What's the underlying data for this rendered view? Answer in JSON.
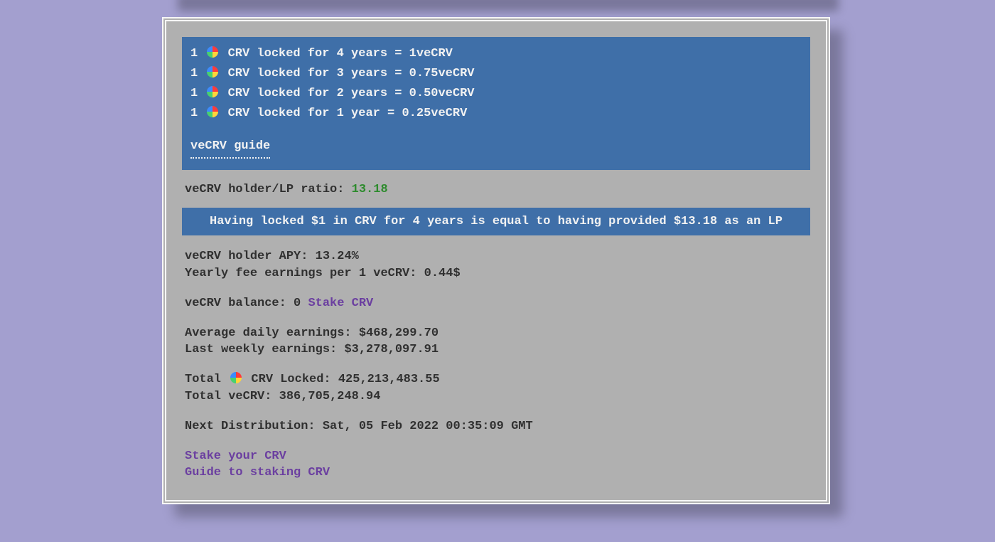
{
  "lock_rates": [
    {
      "prefix": "1",
      "token": "CRV",
      "middle": "locked for 4 years =",
      "result": "1veCRV"
    },
    {
      "prefix": "1",
      "token": "CRV",
      "middle": "locked for 3 years =",
      "result": "0.75veCRV"
    },
    {
      "prefix": "1",
      "token": "CRV",
      "middle": "locked for 2 years =",
      "result": "0.50veCRV"
    },
    {
      "prefix": "1",
      "token": "CRV",
      "middle": "locked for 1 year =",
      "result": "0.25veCRV"
    }
  ],
  "guide_link": "veCRV guide",
  "ratio": {
    "label": "veCRV holder/LP ratio: ",
    "value": "13.18"
  },
  "equivalence": "Having locked $1 in CRV for 4 years is equal to having provided $13.18 as an LP",
  "stats": {
    "apy_label": "veCRV holder APY: ",
    "apy_value": "13.24%",
    "yearly_fee_label": "Yearly fee earnings per 1 veCRV: ",
    "yearly_fee_value": "0.44$",
    "balance_label": "veCRV balance: ",
    "balance_value": "0",
    "stake_link": "Stake CRV",
    "avg_daily_label": "Average daily earnings: ",
    "avg_daily_value": "$468,299.70",
    "last_weekly_label": "Last weekly earnings: ",
    "last_weekly_value": "$3,278,097.91",
    "total_locked_label_pre": "Total ",
    "total_locked_label_post": " CRV Locked: ",
    "total_locked_value": "425,213,483.55",
    "total_vecrv_label": "Total veCRV: ",
    "total_vecrv_value": "386,705,248.94",
    "next_dist_label": "Next Distribution: ",
    "next_dist_value": "Sat, 05 Feb 2022 00:35:09 GMT"
  },
  "bottom_links": {
    "stake": "Stake your CRV",
    "guide": "Guide to staking CRV"
  }
}
